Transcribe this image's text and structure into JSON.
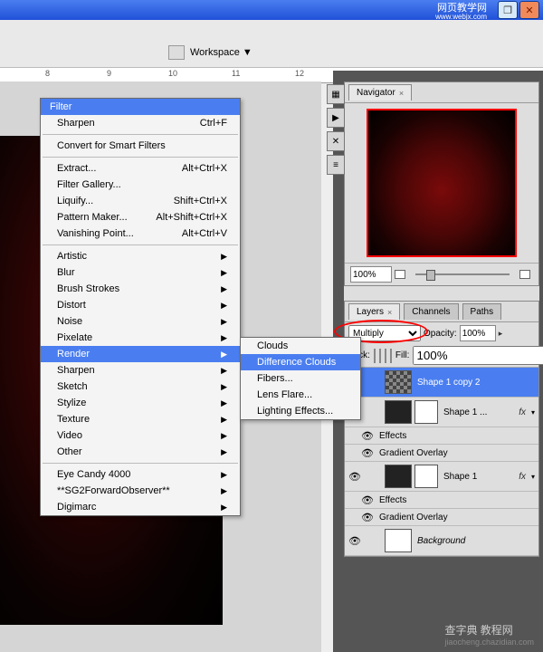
{
  "titlebar": {
    "btn_restore": "❐",
    "btn_close": "✕"
  },
  "watermark_top": {
    "line1": "网页教学网",
    "line2": "www.webjx.com"
  },
  "watermark_bottom": {
    "main": "查字典 教程网",
    "sub": "jiaocheng.chazidian.com"
  },
  "toolbar": {
    "workspace": "Workspace ▼"
  },
  "ruler": {
    "t8": "8",
    "t9": "9",
    "t10": "10",
    "t11": "11",
    "t12": "12"
  },
  "navigator": {
    "tab": "Navigator",
    "zoom": "100%"
  },
  "layers_panel": {
    "tabs": [
      "Layers",
      "Channels",
      "Paths"
    ],
    "blend_mode": "Multiply",
    "opacity_label": "Opacity:",
    "opacity": "100%",
    "lock_label": "Lock:",
    "fill_label": "Fill:",
    "fill": "100%",
    "layers": [
      {
        "name": "Shape 1 copy 2"
      },
      {
        "name": "Shape 1 ...",
        "fx": "fx"
      },
      {
        "name": "Shape 1",
        "fx": "fx"
      },
      {
        "name": "Background"
      }
    ],
    "effects": "Effects",
    "grad": "Gradient Overlay"
  },
  "filter_menu": {
    "title": "Filter",
    "items": [
      {
        "label": "Sharpen",
        "shortcut": "Ctrl+F"
      },
      {
        "sep": true
      },
      {
        "label": "Convert for Smart Filters"
      },
      {
        "sep": true
      },
      {
        "label": "Extract...",
        "shortcut": "Alt+Ctrl+X"
      },
      {
        "label": "Filter Gallery..."
      },
      {
        "label": "Liquify...",
        "shortcut": "Shift+Ctrl+X"
      },
      {
        "label": "Pattern Maker...",
        "shortcut": "Alt+Shift+Ctrl+X"
      },
      {
        "label": "Vanishing Point...",
        "shortcut": "Alt+Ctrl+V"
      },
      {
        "sep": true
      },
      {
        "label": "Artistic",
        "sub": true
      },
      {
        "label": "Blur",
        "sub": true
      },
      {
        "label": "Brush Strokes",
        "sub": true
      },
      {
        "label": "Distort",
        "sub": true
      },
      {
        "label": "Noise",
        "sub": true
      },
      {
        "label": "Pixelate",
        "sub": true
      },
      {
        "label": "Render",
        "sub": true,
        "selected": true
      },
      {
        "label": "Sharpen",
        "sub": true
      },
      {
        "label": "Sketch",
        "sub": true
      },
      {
        "label": "Stylize",
        "sub": true
      },
      {
        "label": "Texture",
        "sub": true
      },
      {
        "label": "Video",
        "sub": true
      },
      {
        "label": "Other",
        "sub": true
      },
      {
        "sep": true
      },
      {
        "label": "Eye Candy 4000",
        "sub": true
      },
      {
        "label": "**SG2ForwardObserver**",
        "sub": true
      },
      {
        "label": "Digimarc",
        "sub": true
      }
    ]
  },
  "render_submenu": [
    {
      "label": "Clouds"
    },
    {
      "label": "Difference Clouds",
      "selected": true
    },
    {
      "label": "Fibers..."
    },
    {
      "label": "Lens Flare..."
    },
    {
      "label": "Lighting Effects..."
    }
  ]
}
